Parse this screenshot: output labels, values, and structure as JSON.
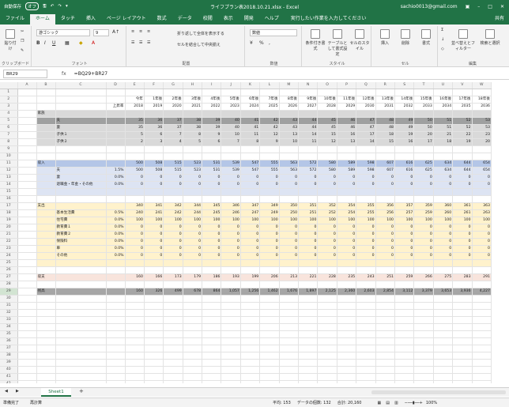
{
  "titlebar": {
    "autosave_label": "自動保存",
    "autosave_state": "オフ",
    "title": "ライフプラン表2018.10.21.xlsx - Excel",
    "user": "sachio0013@gmail.com"
  },
  "tabs": [
    "ファイル",
    "ホーム",
    "タッチ",
    "挿入",
    "ページ レイアウト",
    "数式",
    "データ",
    "校閲",
    "表示",
    "開発",
    "ヘルプ"
  ],
  "active_tab": 1,
  "tell_me": "実行したい作業を入力してください",
  "share": "共有",
  "ribbon": {
    "paste": "貼り付け",
    "clipboard": "クリップボード",
    "font_name": "游ゴシック",
    "font_size": "9",
    "font": "フォント",
    "wrap": "折り返して全体を表示する",
    "merge": "セルを結合して中央揃え",
    "alignment": "配置",
    "number_format": "数値",
    "number": "数値",
    "cond_format": "条件付き書式",
    "table_format": "テーブルとして書式設定",
    "cell_style": "セルのスタイル",
    "styles": "スタイル",
    "insert": "挿入",
    "delete": "削除",
    "format": "書式",
    "cells": "セル",
    "sort": "並べ替えとフィルター",
    "find": "検索と選択",
    "edit": "編集"
  },
  "formula_bar": {
    "namebox": "BR29",
    "fx": "fx",
    "formula": "=BQ29+BR27"
  },
  "columns": [
    "A",
    "B",
    "C",
    "D",
    "E",
    "F",
    "G",
    "H",
    "I",
    "J",
    "K",
    "L",
    "M",
    "N",
    "O",
    "P",
    "Q",
    "R",
    "S",
    "T",
    "U",
    "V",
    "W"
  ],
  "rows": [
    {
      "n": "1",
      "s": "",
      "c": []
    },
    {
      "n": "2",
      "s": "",
      "c": [
        "",
        "",
        "",
        "",
        "今年",
        "1年後",
        "2年後",
        "3年後",
        "4年後",
        "5年後",
        "6年後",
        "7年後",
        "8年後",
        "9年後",
        "10年後",
        "11年後",
        "12年後",
        "13年後",
        "14年後",
        "15年後",
        "16年後",
        "17年後",
        "18年後"
      ]
    },
    {
      "n": "3",
      "s": "",
      "c": [
        "",
        "",
        "",
        "上昇率",
        "2018",
        "2019",
        "2020",
        "2021",
        "2022",
        "2023",
        "2024",
        "2025",
        "2026",
        "2027",
        "2028",
        "2029",
        "2030",
        "2031",
        "2032",
        "2033",
        "2034",
        "2035",
        "2036"
      ]
    },
    {
      "n": "4",
      "s": "s-gray",
      "c": [
        "",
        "家族"
      ]
    },
    {
      "n": "5",
      "s": "s-gray2",
      "c": [
        "",
        "",
        "夫",
        "",
        "35",
        "36",
        "37",
        "38",
        "39",
        "40",
        "41",
        "42",
        "43",
        "44",
        "45",
        "46",
        "47",
        "48",
        "49",
        "50",
        "51",
        "52",
        "53"
      ]
    },
    {
      "n": "6",
      "s": "s-gray",
      "c": [
        "",
        "",
        "妻",
        "",
        "35",
        "36",
        "37",
        "38",
        "39",
        "40",
        "41",
        "42",
        "43",
        "44",
        "45",
        "46",
        "47",
        "48",
        "49",
        "50",
        "51",
        "52",
        "53"
      ]
    },
    {
      "n": "7",
      "s": "s-gray",
      "c": [
        "",
        "",
        "子供１",
        "",
        "5",
        "6",
        "7",
        "8",
        "9",
        "10",
        "11",
        "12",
        "13",
        "14",
        "15",
        "16",
        "17",
        "18",
        "19",
        "20",
        "21",
        "22",
        "23"
      ]
    },
    {
      "n": "8",
      "s": "s-gray",
      "c": [
        "",
        "",
        "子供２",
        "",
        "2",
        "3",
        "4",
        "5",
        "6",
        "7",
        "8",
        "9",
        "10",
        "11",
        "12",
        "13",
        "14",
        "15",
        "16",
        "17",
        "18",
        "19",
        "20"
      ]
    },
    {
      "n": "9",
      "s": "",
      "c": []
    },
    {
      "n": "10",
      "s": "",
      "c": []
    },
    {
      "n": "11",
      "s": "s-blue",
      "c": [
        "",
        "収入",
        "",
        "",
        "500",
        "508",
        "515",
        "523",
        "531",
        "539",
        "547",
        "555",
        "563",
        "572",
        "580",
        "589",
        "598",
        "607",
        "616",
        "625",
        "634",
        "644",
        "654"
      ]
    },
    {
      "n": "12",
      "s": "s-lblue",
      "c": [
        "",
        "",
        "夫",
        "1.5%",
        "500",
        "508",
        "515",
        "523",
        "531",
        "539",
        "547",
        "555",
        "563",
        "572",
        "580",
        "589",
        "598",
        "607",
        "616",
        "625",
        "634",
        "644",
        "654"
      ]
    },
    {
      "n": "13",
      "s": "s-lblue",
      "c": [
        "",
        "",
        "妻",
        "0.0%",
        "0",
        "0",
        "0",
        "0",
        "0",
        "0",
        "0",
        "0",
        "0",
        "0",
        "0",
        "0",
        "0",
        "0",
        "0",
        "0",
        "0",
        "0",
        "0"
      ]
    },
    {
      "n": "14",
      "s": "s-lblue",
      "c": [
        "",
        "",
        "退職金・年金・その他",
        "0.0%",
        "0",
        "0",
        "0",
        "0",
        "0",
        "0",
        "0",
        "0",
        "0",
        "0",
        "0",
        "0",
        "0",
        "0",
        "0",
        "0",
        "0",
        "0",
        "0"
      ]
    },
    {
      "n": "15",
      "s": "s-lblue",
      "c": []
    },
    {
      "n": "16",
      "s": "",
      "c": []
    },
    {
      "n": "17",
      "s": "s-yel",
      "c": [
        "",
        "支出",
        "",
        "",
        "340",
        "341",
        "342",
        "344",
        "345",
        "346",
        "347",
        "349",
        "350",
        "351",
        "352",
        "354",
        "355",
        "356",
        "357",
        "359",
        "360",
        "361",
        "363"
      ]
    },
    {
      "n": "18",
      "s": "s-yel",
      "c": [
        "",
        "",
        "基本生活費",
        "0.5%",
        "240",
        "241",
        "242",
        "244",
        "245",
        "246",
        "247",
        "249",
        "250",
        "251",
        "252",
        "254",
        "255",
        "256",
        "257",
        "259",
        "260",
        "261",
        "263"
      ]
    },
    {
      "n": "19",
      "s": "s-yel",
      "c": [
        "",
        "",
        "住宅費",
        "0.0%",
        "100",
        "100",
        "100",
        "100",
        "100",
        "100",
        "100",
        "100",
        "100",
        "100",
        "100",
        "100",
        "100",
        "100",
        "100",
        "100",
        "100",
        "100",
        "100"
      ]
    },
    {
      "n": "20",
      "s": "s-yel",
      "c": [
        "",
        "",
        "教育費１",
        "0.0%",
        "0",
        "0",
        "0",
        "0",
        "0",
        "0",
        "0",
        "0",
        "0",
        "0",
        "0",
        "0",
        "0",
        "0",
        "0",
        "0",
        "0",
        "0",
        "0"
      ]
    },
    {
      "n": "21",
      "s": "s-yel",
      "c": [
        "",
        "",
        "教育費２",
        "0.0%",
        "0",
        "0",
        "0",
        "0",
        "0",
        "0",
        "0",
        "0",
        "0",
        "0",
        "0",
        "0",
        "0",
        "0",
        "0",
        "0",
        "0",
        "0",
        "0"
      ]
    },
    {
      "n": "22",
      "s": "s-yel",
      "c": [
        "",
        "",
        "保険料",
        "0.0%",
        "0",
        "0",
        "0",
        "0",
        "0",
        "0",
        "0",
        "0",
        "0",
        "0",
        "0",
        "0",
        "0",
        "0",
        "0",
        "0",
        "0",
        "0",
        "0"
      ]
    },
    {
      "n": "23",
      "s": "s-yel",
      "c": [
        "",
        "",
        "車",
        "0.0%",
        "0",
        "0",
        "0",
        "0",
        "0",
        "0",
        "0",
        "0",
        "0",
        "0",
        "0",
        "0",
        "0",
        "0",
        "0",
        "0",
        "0",
        "0",
        "0"
      ]
    },
    {
      "n": "24",
      "s": "s-yel",
      "c": [
        "",
        "",
        "その他",
        "0.0%",
        "0",
        "0",
        "0",
        "0",
        "0",
        "0",
        "0",
        "0",
        "0",
        "0",
        "0",
        "0",
        "0",
        "0",
        "0",
        "0",
        "0",
        "0",
        "0"
      ]
    },
    {
      "n": "25",
      "s": "s-yel",
      "c": []
    },
    {
      "n": "26",
      "s": "",
      "c": []
    },
    {
      "n": "27",
      "s": "s-pink",
      "c": [
        "",
        "収支",
        "",
        "",
        "160",
        "166",
        "173",
        "179",
        "186",
        "193",
        "199",
        "206",
        "213",
        "221",
        "228",
        "235",
        "243",
        "251",
        "259",
        "266",
        "275",
        "283",
        "291"
      ]
    },
    {
      "n": "28",
      "s": "",
      "c": []
    },
    {
      "n": "29",
      "s": "s-dk",
      "c": [
        "",
        "残高",
        "",
        "",
        "160",
        "326",
        "499",
        "678",
        "864",
        "1,057",
        "1,256",
        "1,462",
        "1,676",
        "1,897",
        "2,125",
        "2,360",
        "2,603",
        "2,854",
        "3,112",
        "3,379",
        "3,653",
        "3,936",
        "4,227"
      ]
    },
    {
      "n": "30",
      "s": "",
      "c": []
    },
    {
      "n": "31",
      "s": "",
      "c": []
    },
    {
      "n": "32",
      "s": "",
      "c": []
    },
    {
      "n": "33",
      "s": "",
      "c": []
    },
    {
      "n": "34",
      "s": "",
      "c": []
    },
    {
      "n": "35",
      "s": "",
      "c": []
    },
    {
      "n": "36",
      "s": "",
      "c": []
    },
    {
      "n": "37",
      "s": "",
      "c": []
    },
    {
      "n": "38",
      "s": "",
      "c": []
    },
    {
      "n": "39",
      "s": "",
      "c": []
    },
    {
      "n": "40",
      "s": "",
      "c": []
    },
    {
      "n": "41",
      "s": "",
      "c": []
    },
    {
      "n": "42",
      "s": "",
      "c": []
    },
    {
      "n": "43",
      "s": "",
      "c": []
    }
  ],
  "sheet": {
    "name": "Sheet1",
    "add": "+"
  },
  "status": {
    "ready": "準備完了",
    "recalc": "再計算",
    "average": "平均: 153",
    "count": "データの個数: 132",
    "sum": "合計: 20,160",
    "zoom": "100%"
  },
  "colors": {
    "accent": "#217346"
  }
}
